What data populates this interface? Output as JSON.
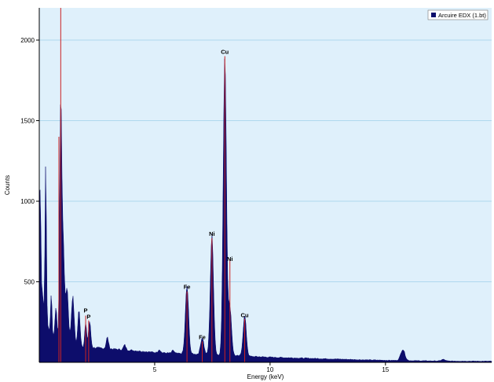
{
  "chart_data": {
    "type": "area",
    "xlabel": "Energy (keV)",
    "ylabel": "Counts",
    "xlim": [
      0,
      19.6
    ],
    "ylim": [
      0,
      2200
    ],
    "xticks": [
      5,
      10,
      15
    ],
    "yticks": [
      500,
      1000,
      1500,
      2000
    ],
    "grid": "horizontal",
    "legend_position": "top-right",
    "colors": {
      "plot_background": "#dff0fb",
      "spectrum_fill": "#0d0d6b",
      "marker_line": "#cc2222",
      "grid": "#9fd0ea"
    },
    "series": [
      {
        "name": "Arcuire EDX (1.bt)",
        "background": [
          [
            0,
            1000
          ],
          [
            0.1,
            500
          ],
          [
            0.25,
            250
          ],
          [
            0.6,
            160
          ],
          [
            1.0,
            120
          ],
          [
            2.0,
            95
          ],
          [
            3.0,
            85
          ],
          [
            4.0,
            75
          ],
          [
            5.0,
            62
          ],
          [
            6.0,
            55
          ],
          [
            7.0,
            50
          ],
          [
            8.0,
            45
          ],
          [
            9.0,
            38
          ],
          [
            10.0,
            32
          ],
          [
            11.0,
            28
          ],
          [
            12.0,
            24
          ],
          [
            13.0,
            20
          ],
          [
            14.0,
            16
          ],
          [
            15.0,
            13
          ],
          [
            16.0,
            11
          ],
          [
            17.0,
            9
          ],
          [
            18.0,
            8
          ],
          [
            19.6,
            7
          ]
        ],
        "peaks": [
          {
            "x": 0.05,
            "height": 420,
            "width": 0.015
          },
          {
            "x": 0.28,
            "height": 1000,
            "width": 0.03
          },
          {
            "x": 0.52,
            "height": 250,
            "width": 0.03
          },
          {
            "x": 0.72,
            "height": 200,
            "width": 0.04
          },
          {
            "x": 0.93,
            "height": 1500,
            "width": 0.045
          },
          {
            "x": 1.04,
            "height": 600,
            "width": 0.05
          },
          {
            "x": 1.2,
            "height": 350,
            "width": 0.06
          },
          {
            "x": 1.45,
            "height": 300,
            "width": 0.06
          },
          {
            "x": 1.72,
            "height": 220,
            "width": 0.05
          },
          {
            "x": 2.01,
            "height": 150,
            "width": 0.04
          },
          {
            "x": 2.18,
            "height": 160,
            "width": 0.05
          },
          {
            "x": 2.95,
            "height": 70,
            "width": 0.05
          },
          {
            "x": 3.7,
            "height": 30,
            "width": 0.05
          },
          {
            "x": 5.2,
            "height": 20,
            "width": 0.05
          },
          {
            "x": 5.8,
            "height": 18,
            "width": 0.05
          },
          {
            "x": 6.4,
            "height": 420,
            "width": 0.07
          },
          {
            "x": 7.06,
            "height": 105,
            "width": 0.07
          },
          {
            "x": 7.48,
            "height": 740,
            "width": 0.07
          },
          {
            "x": 8.04,
            "height": 1860,
            "width": 0.07
          },
          {
            "x": 8.26,
            "height": 300,
            "width": 0.07
          },
          {
            "x": 8.9,
            "height": 250,
            "width": 0.07
          },
          {
            "x": 15.75,
            "height": 70,
            "width": 0.09
          },
          {
            "x": 17.5,
            "height": 10,
            "width": 0.08
          }
        ]
      }
    ],
    "annotations": [
      {
        "label": "P",
        "x": 2.01,
        "y": 310
      },
      {
        "label": "P",
        "x": 2.14,
        "y": 270
      },
      {
        "label": "Fe",
        "x": 6.4,
        "y": 455
      },
      {
        "label": "Fe",
        "x": 7.06,
        "y": 145
      },
      {
        "label": "Ni",
        "x": 7.48,
        "y": 785
      },
      {
        "label": "Ni",
        "x": 8.26,
        "y": 630
      },
      {
        "label": "Cu",
        "x": 8.04,
        "y": 1915
      },
      {
        "label": "Cu",
        "x": 8.9,
        "y": 280
      }
    ],
    "markers": [
      {
        "x": 2.01,
        "y_top": 290
      },
      {
        "x": 2.14,
        "y_top": 260
      },
      {
        "x": 6.4,
        "y_top": 440
      },
      {
        "x": 7.06,
        "y_top": 130
      },
      {
        "x": 7.48,
        "y_top": 770
      },
      {
        "x": 8.04,
        "y_top": 1900
      },
      {
        "x": 8.26,
        "y_top": 640
      },
      {
        "x": 8.9,
        "y_top": 270
      },
      {
        "x": 0.93,
        "y_top": 2200
      },
      {
        "x": 0.85,
        "y_top": 1400
      }
    ]
  }
}
